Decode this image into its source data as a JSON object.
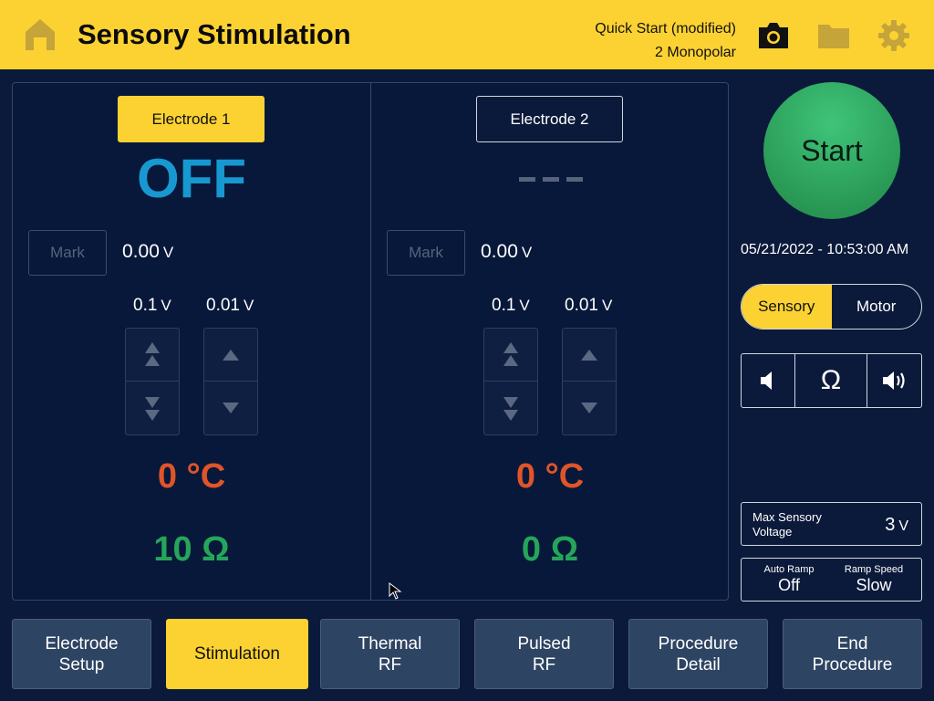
{
  "header": {
    "title": "Sensory Stimulation",
    "preset_line1": "Quick Start (modified)",
    "preset_line2": "2 Monopolar",
    "icons": [
      "home-icon",
      "camera-icon",
      "folder-icon",
      "gear-icon"
    ],
    "background_color": "#fcd232"
  },
  "electrodes": [
    {
      "label": "Electrode 1",
      "selected": true,
      "status": "OFF",
      "mark_label": "Mark",
      "voltage": "0.00",
      "voltage_unit": "V",
      "coarse_step": "0.1",
      "fine_step": "0.01",
      "step_unit": "V",
      "temperature": "0 °C",
      "impedance": "10 Ω"
    },
    {
      "label": "Electrode 2",
      "selected": false,
      "status": "---",
      "mark_label": "Mark",
      "voltage": "0.00",
      "voltage_unit": "V",
      "coarse_step": "0.1",
      "fine_step": "0.01",
      "step_unit": "V",
      "temperature": "0 °C",
      "impedance": "0 Ω"
    }
  ],
  "controls": {
    "start_label": "Start",
    "datetime": "05/21/2022 - 10:53:00 AM",
    "mode_options": [
      "Sensory",
      "Motor"
    ],
    "mode_selected": "Sensory",
    "sound_buttons": [
      "volume-down-icon",
      "omega-icon",
      "volume-up-icon"
    ],
    "omega_symbol": "Ω",
    "max_label": "Max Sensory Voltage",
    "max_value": "3",
    "max_unit": "V",
    "auto_ramp_label": "Auto Ramp",
    "auto_ramp_value": "Off",
    "ramp_speed_label": "Ramp Speed",
    "ramp_speed_value": "Slow"
  },
  "nav": [
    {
      "line1": "Electrode",
      "line2": "Setup",
      "active": false
    },
    {
      "line1": "Stimulation",
      "line2": "",
      "active": true
    },
    {
      "line1": "Thermal",
      "line2": "RF",
      "active": false
    },
    {
      "line1": "Pulsed",
      "line2": "RF",
      "active": false
    },
    {
      "line1": "Procedure",
      "line2": "Detail",
      "active": false
    },
    {
      "line1": "End",
      "line2": "Procedure",
      "active": false
    }
  ],
  "colors": {
    "accent": "#fcd232",
    "background": "#0b1a3a",
    "status_off": "#1798d0",
    "temperature": "#e05429",
    "impedance": "#25a55a",
    "start": "#2a9a56"
  }
}
